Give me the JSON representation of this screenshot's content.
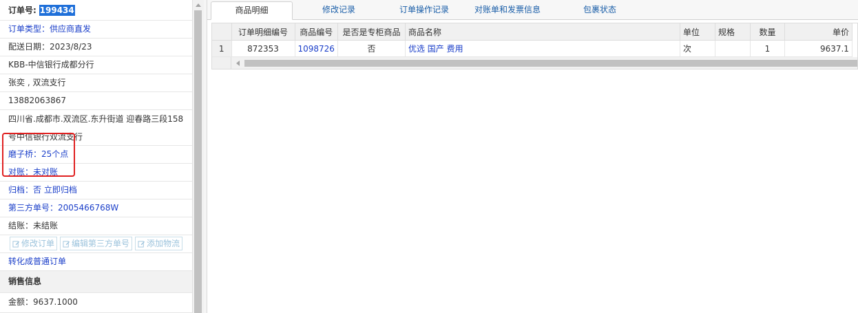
{
  "left": {
    "order_no_label": "订单号:",
    "order_no_value": "199434",
    "order_type": "订单类型：供应商直发",
    "delivery_date": "配送日期：2023/8/23",
    "bank_branch": "KBB-中信银行成都分行",
    "contact": "张奕 , 双流支行",
    "phone": "13882063867",
    "address_line1": "四川省.成都市.双流区.东升街道 迎春路三段158",
    "address_line2": "号中信银行双流支行",
    "mozi_bridge": "磨子桥：25个点",
    "reconcile": "对账：未对账",
    "archive": "归档：否 立即归档",
    "third_party_no": "第三方单号：2005466768W",
    "settlement": "结账：未结账",
    "buttons": {
      "modify_order": "修改订单",
      "edit_third_party": "编辑第三方单号",
      "add_logistics": "添加物流"
    },
    "convert_normal": "转化成普通订单",
    "sales_info": "销售信息",
    "amount": "金额：9637.1000"
  },
  "tabs": [
    {
      "label": "商品明细"
    },
    {
      "label": "修改记录"
    },
    {
      "label": "订单操作记录"
    },
    {
      "label": "对账单和发票信息"
    },
    {
      "label": "包裹状态"
    }
  ],
  "grid": {
    "headers": {
      "row_no": "",
      "detail_no": "订单明细编号",
      "product_no": "商品编号",
      "is_cabinet": "是否是专柜商品",
      "product_name": "商品名称",
      "unit": "单位",
      "spec": "规格",
      "qty": "数量",
      "price": "单价"
    },
    "rows": [
      {
        "row_no": "1",
        "detail_no": "872353",
        "product_no": "1098726",
        "is_cabinet": "否",
        "product_name": "优选 国产 费用",
        "unit": "次",
        "spec": "",
        "qty": "1",
        "price": "9637.1"
      }
    ]
  },
  "colors": {
    "accent_blue": "#1a3ec9",
    "link_blue": "#1a5ea8",
    "highlight": "#1e6fd9",
    "annotation_red": "#e02020"
  }
}
